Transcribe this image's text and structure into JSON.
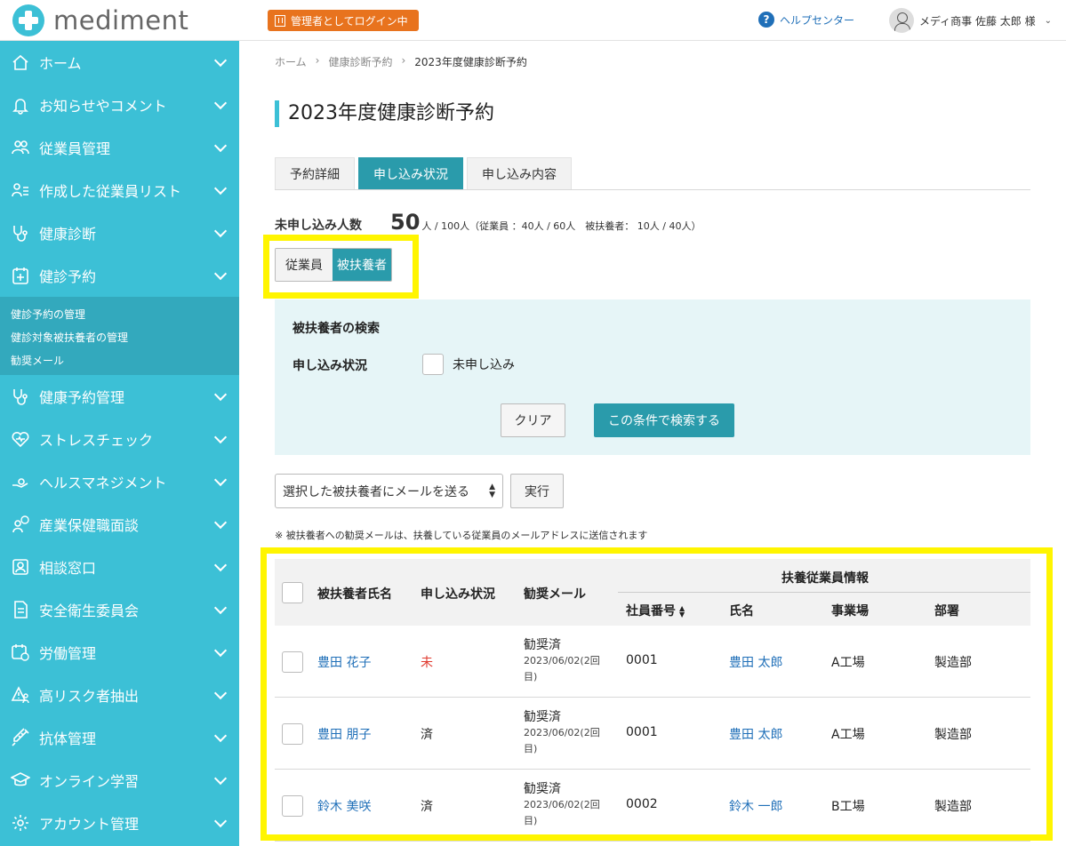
{
  "header": {
    "logo_text": "mediment",
    "admin_badge": "管理者としてログイン中",
    "help_label": "ヘルプセンター",
    "user_name": "メディ商事 佐藤 太郎 様"
  },
  "sidebar": {
    "items": [
      {
        "label": "ホーム",
        "icon": "home-icon"
      },
      {
        "label": "お知らせやコメント",
        "icon": "bell-icon"
      },
      {
        "label": "従業員管理",
        "icon": "people-icon"
      },
      {
        "label": "作成した従業員リスト",
        "icon": "list-user-icon"
      },
      {
        "label": "健康診断",
        "icon": "stethoscope-icon"
      },
      {
        "label": "健診予約",
        "icon": "calendar-plus-icon"
      }
    ],
    "subitems": [
      "健診予約の管理",
      "健診対象被扶養者の管理",
      "勧奨メール"
    ],
    "items_after": [
      {
        "label": "健康予約管理",
        "icon": "stethoscope-icon"
      },
      {
        "label": "ストレスチェック",
        "icon": "heart-icon"
      },
      {
        "label": "ヘルスマネジメント",
        "icon": "hand-icon"
      },
      {
        "label": "産業保健職面談",
        "icon": "chat-user-icon"
      },
      {
        "label": "相談窓口",
        "icon": "id-card-icon"
      },
      {
        "label": "安全衛生委員会",
        "icon": "document-icon"
      },
      {
        "label": "労働管理",
        "icon": "calendar-clock-icon"
      },
      {
        "label": "高リスク者抽出",
        "icon": "warning-user-icon"
      },
      {
        "label": "抗体管理",
        "icon": "syringe-icon"
      },
      {
        "label": "オンライン学習",
        "icon": "graduation-icon"
      },
      {
        "label": "アカウント管理",
        "icon": "gear-icon"
      }
    ]
  },
  "breadcrumb": [
    "ホーム",
    "健康診断予約",
    "2023年度健康診断予約"
  ],
  "page_title": "2023年度健康診断予約",
  "tabs": [
    "予約詳細",
    "申し込み状況",
    "申し込み内容"
  ],
  "counts": {
    "label": "未申し込み人数",
    "value": "50",
    "detail": "人 / 100人（従業員 ：40人 / 60人　被扶養者： 10人 / 40人）"
  },
  "toggle": [
    "従業員",
    "被扶養者"
  ],
  "search": {
    "title": "被扶養者の検索",
    "status_label": "申し込み状況",
    "checkbox_label": "未申し込み",
    "clear_label": "クリア",
    "submit_label": "この条件で検索する"
  },
  "bulk_action": {
    "selected": "選択した被扶養者にメールを送る",
    "exec_label": "実行"
  },
  "note": "※ 被扶養者への勧奨メールは、扶養している従業員のメールアドレスに送信されます",
  "table": {
    "headers": {
      "name": "被扶養者氏名",
      "status": "申し込み状況",
      "mail": "勧奨メール",
      "group": "扶養従業員情報",
      "emp_no": "社員番号",
      "emp_name": "氏名",
      "site": "事業場",
      "dept": "部署"
    },
    "rows": [
      {
        "name": "豊田 花子",
        "status": "未",
        "mail": "勧奨済",
        "mail_date": "2023/06/02(2回",
        "mail_date2": "目)",
        "emp_no": "0001",
        "emp_name": "豊田 太郎",
        "site": "A工場",
        "dept": "製造部"
      },
      {
        "name": "豊田 朋子",
        "status": "済",
        "mail": "勧奨済",
        "mail_date": "2023/06/02(2回",
        "mail_date2": "目)",
        "emp_no": "0001",
        "emp_name": "豊田 太郎",
        "site": "A工場",
        "dept": "製造部"
      },
      {
        "name": "鈴木 美咲",
        "status": "済",
        "mail": "勧奨済",
        "mail_date": "2023/06/02(2回",
        "mail_date2": "目)",
        "emp_no": "0002",
        "emp_name": "鈴木 一郎",
        "site": "B工場",
        "dept": "製造部"
      }
    ]
  },
  "colors": {
    "sidebar": "#3cc0d6",
    "accent": "#2a9bab",
    "highlight": "#fff500",
    "link": "#1f6fb8",
    "badge": "#e8731e",
    "danger": "#e03a2f"
  }
}
